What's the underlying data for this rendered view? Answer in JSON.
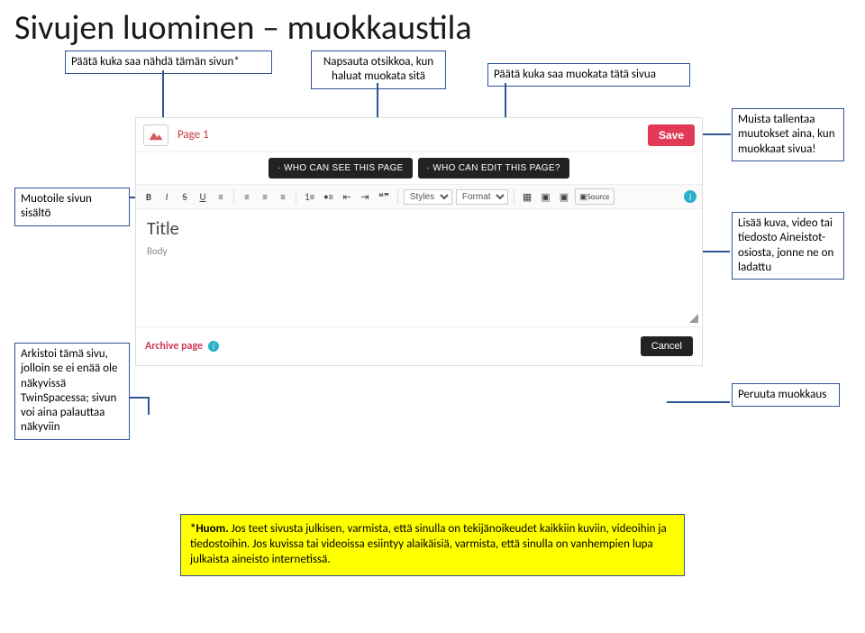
{
  "title": "Sivujen luominen – muokkaustila",
  "callouts": {
    "who_see": "Päätä kuka saa nähdä tämän sivun*",
    "click_title": "Napsauta otsikkoa, kun haluat muokata sitä",
    "who_edit": "Päätä kuka saa muokata tätä sivua",
    "save": "Muista tallentaa muutokset aina, kun muokkaat sivua!",
    "format": "Muotoile sivun sisältö",
    "insert": "Lisää kuva, video tai tiedosto Aineistot-osiosta, jonne ne on ladattu",
    "archive": "Arkistoi tämä sivu, jolloin se ei enää ole näkyvissä TwinSpacessa; sivun voi aina palauttaa näkyviin",
    "cancel": "Peruuta muokkaus"
  },
  "screen": {
    "page_label": "Page 1",
    "save_btn": "Save",
    "who_see_btn": "· WHO CAN SEE THIS PAGE",
    "who_edit_btn": "· WHO CAN EDIT THIS PAGE?",
    "toolbar": {
      "bold": "B",
      "italic": "I",
      "strike": "S",
      "underline": "U",
      "clear": "≡",
      "align_l": "≡",
      "align_c": "≡",
      "align_r": "≡",
      "list_ol": "1≡",
      "list_ul": "•≡",
      "outdent": "⇤",
      "indent": "⇥",
      "quote": "❝❞",
      "styles": "Styles",
      "format": "Format",
      "table": "▦",
      "media1": "▣",
      "media2": "▣",
      "source": "Source"
    },
    "editor_title": "Title",
    "editor_body": "Body",
    "archive_label": "Archive page",
    "cancel_btn": "Cancel"
  },
  "note": "*Huom. Jos teet sivusta julkisen, varmista, että sinulla on tekijänoikeudet kaikkiin kuviin, videoihin ja tiedostoihin. Jos kuvissa tai videoissa esiintyy alaikäisiä, varmista, että sinulla on vanhempien lupa julkaista aineisto internetissä."
}
